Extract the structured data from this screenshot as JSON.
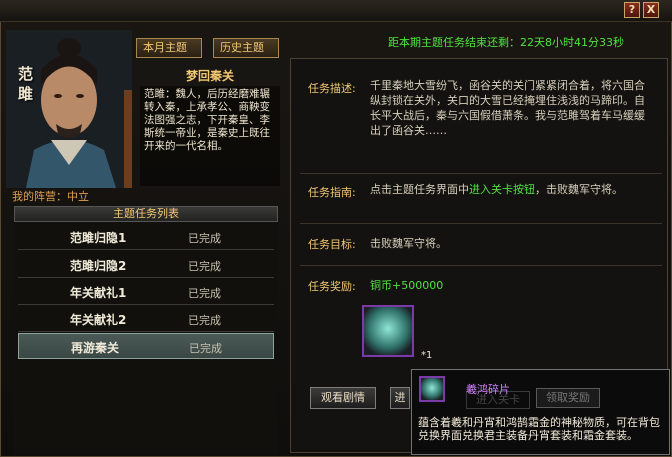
{
  "window": {
    "help_glyph": "?",
    "close_glyph": "X"
  },
  "character": {
    "name_char1": "范",
    "name_char2": "雎",
    "camp_label": "我的阵营：",
    "camp_value": "中立"
  },
  "tabs": {
    "month": "本月主题",
    "history": "历史主题"
  },
  "story": {
    "title": "梦回秦关",
    "text": "范雎：魏人，后历经磨难辗转入秦，上承孝公、商鞅变法图强之志，下开秦皇、李斯统一帝业，是秦史上既往开来的一代名相。"
  },
  "quest_list": {
    "header": "主题任务列表",
    "items": [
      {
        "name": "范雎归隐1",
        "status": "已完成"
      },
      {
        "name": "范雎归隐2",
        "status": "已完成"
      },
      {
        "name": "年关献礼1",
        "status": "已完成"
      },
      {
        "name": "年关献礼2",
        "status": "已完成"
      },
      {
        "name": "再游秦关",
        "status": "已完成"
      }
    ]
  },
  "countdown": "距本期主题任务结束还剩：22天8小时41分33秒",
  "details": {
    "desc_label": "任务描述:",
    "desc_text": "千里秦地大雪纷飞，函谷关的关门紧紧闭合着，将六国合纵封锁在关外，关口的大雪已经掩埋住浅浅的马蹄印。自长平大战后，秦与六国假借萧条。我与范雎驾着车马缓缓出了函谷关……",
    "guide_label": "任务指南:",
    "guide_text_pre": "点击主题任务界面中",
    "guide_link": "进入关卡按钮",
    "guide_text_post": "，击败魏军守将。",
    "target_label": "任务目标:",
    "target_text": "击败魏军守将。",
    "reward_label": "任务奖励:",
    "reward_text": "铜币+500000",
    "reward_count": "*1"
  },
  "buttons": {
    "story": "观看剧情",
    "enter": "进"
  },
  "tooltip": {
    "title": "羲鸿碎片",
    "ghost_btn1": "进入关卡",
    "ghost_btn2": "领取奖励",
    "desc": "蕴含着羲和丹宵和鸿鹄霜金的神秘物质，可在背包兑换界面兑换君主装备丹宵套装和霜金套装。"
  },
  "colors": {
    "gold": "#f3c873",
    "green": "#4fe33f",
    "purple": "#d080ff",
    "active_row": "#4b5a57"
  }
}
